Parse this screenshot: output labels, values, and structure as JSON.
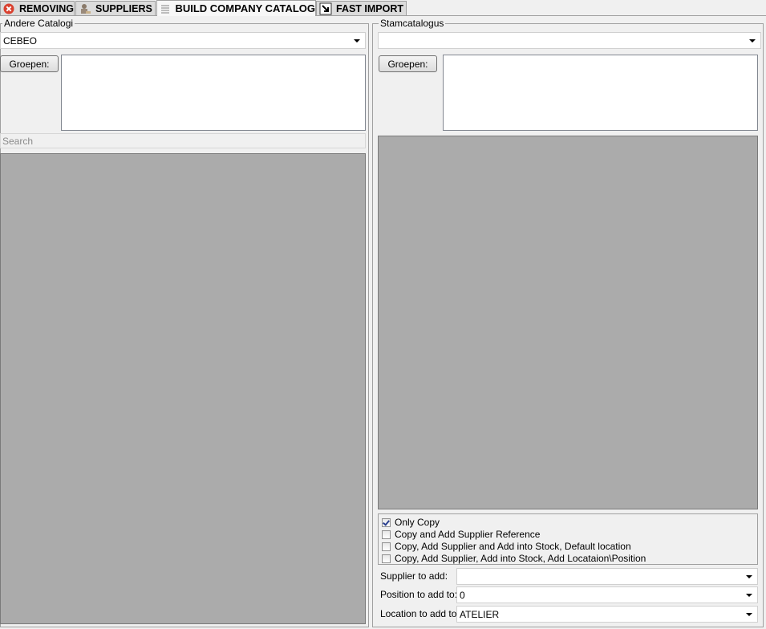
{
  "tabs": [
    {
      "label": "REMOVING",
      "icon": "remove-icon"
    },
    {
      "label": "SUPPLIERS",
      "icon": "supplier-icon"
    },
    {
      "label": "BUILD COMPANY CATALOG",
      "icon": "list-icon"
    },
    {
      "label": "FAST IMPORT",
      "icon": "import-icon"
    }
  ],
  "active_tab": "BUILD COMPANY CATALOG",
  "left": {
    "title": "Andere Catalogi",
    "catalog_value": "CEBEO",
    "groups_button": "Groepen:",
    "search_placeholder": "Search"
  },
  "right": {
    "title": "Stamcatalogus",
    "catalog_value": "",
    "groups_button": "Groepen:",
    "options": [
      {
        "label": "Only Copy",
        "checked": true
      },
      {
        "label": "Copy and Add Supplier Reference",
        "checked": false
      },
      {
        "label": "Copy, Add Supplier and Add into Stock, Default location",
        "checked": false
      },
      {
        "label": "Copy, Add Supplier, Add into Stock, Add Locataion\\Position",
        "checked": false
      }
    ],
    "supplier_label": "Supplier to add:",
    "supplier_value": "",
    "position_label": "Position to add to:",
    "position_value": "0",
    "location_label": "Location to add to:",
    "location_value": "ATELIER"
  }
}
